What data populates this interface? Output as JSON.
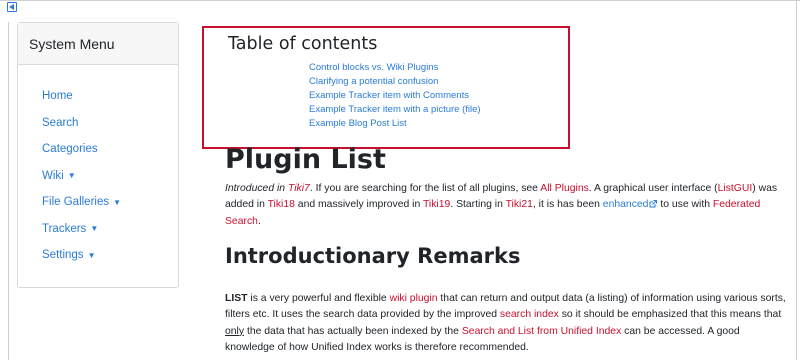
{
  "colors": {
    "link": "#2a7bd6",
    "wiki_link": "#c8102e",
    "toc_border": "#c8102e"
  },
  "sidebar": {
    "title": "System Menu",
    "items": [
      {
        "label": "Home",
        "caret": false
      },
      {
        "label": "Search",
        "caret": false
      },
      {
        "label": "Categories",
        "caret": false
      },
      {
        "label": "Wiki",
        "caret": true
      },
      {
        "label": "File Galleries",
        "caret": true
      },
      {
        "label": "Trackers",
        "caret": true
      },
      {
        "label": "Settings",
        "caret": true
      }
    ]
  },
  "toc": {
    "title": "Table of contents",
    "items": [
      "Control blocks vs. Wiki Plugins",
      "Clarifying a potential confusion",
      "Example Tracker item with Comments",
      "Example Tracker item with a picture (file)",
      "Example Blog Post List"
    ]
  },
  "page": {
    "title": "Plugin List",
    "intro": {
      "t1": "Introduced in ",
      "tiki7": "Tiki7",
      "t2": ". If you are searching for the list of all plugins, see ",
      "all_plugins": "All Plugins",
      "t3": ". A graphical user interface (",
      "listgui": "ListGUI",
      "t4": ") was added in ",
      "tiki18": "Tiki18",
      "t5": " and massively improved in ",
      "tiki19": "Tiki19",
      "t6": ". Starting in ",
      "tiki21": "Tiki21",
      "t7": ", it is has been ",
      "enhanced": "enhanced",
      "t8": " to use with ",
      "federated": "Federated Search",
      "t9": "."
    },
    "section_title": "Introductionary Remarks",
    "remarks": {
      "list_bold": "LIST",
      "r1": " is a very powerful and flexible ",
      "wiki_plugin": "wiki plugin",
      "r2": " that can return and output data (a listing) of information using various sorts, filters etc. It uses the search data provided by the improved ",
      "search_index": "search index",
      "r3": " so it should be emphasized that this means that ",
      "only": "only",
      "r4": " the data that has actually been indexed by the ",
      "search_list": "Search and List from Unified Index",
      "r5": " can be accessed. A good knowledge of how Unified Index works is therefore recommended."
    }
  }
}
